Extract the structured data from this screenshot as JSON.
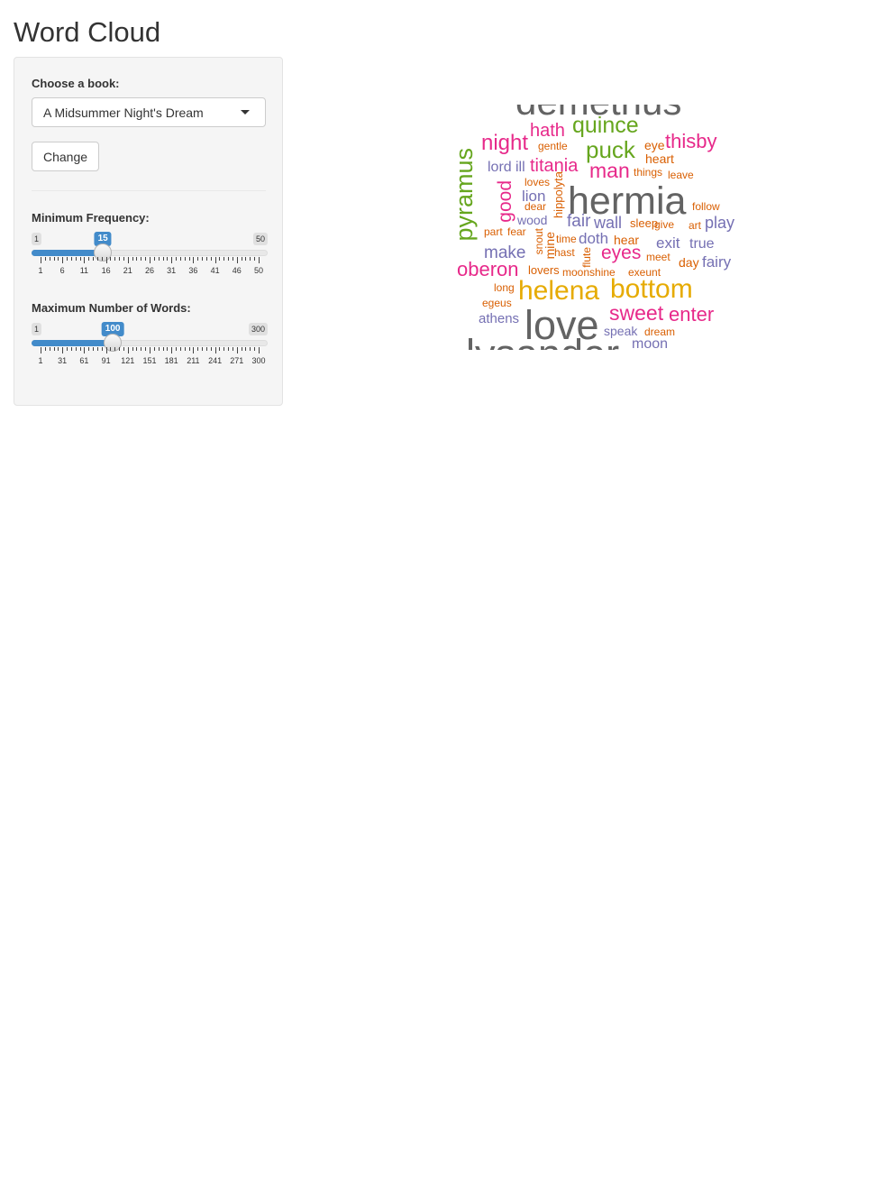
{
  "title": "Word Cloud",
  "sidebar": {
    "book_label": "Choose a book:",
    "book_selected": "A Midsummer Night's Dream",
    "change_button": "Change",
    "min_freq": {
      "label": "Minimum Frequency:",
      "min": 1,
      "max": 50,
      "value": 15,
      "min_text": "1",
      "max_text": "50",
      "value_text": "15",
      "ticks": [
        "1",
        "6",
        "11",
        "16",
        "21",
        "26",
        "31",
        "36",
        "41",
        "46",
        "50"
      ]
    },
    "max_words": {
      "label": "Maximum Number of Words:",
      "min": 1,
      "max": 300,
      "value": 100,
      "min_text": "1",
      "max_text": "300",
      "value_text": "100",
      "ticks": [
        "1",
        "31",
        "61",
        "91",
        "121",
        "151",
        "181",
        "211",
        "241",
        "271",
        "300"
      ]
    }
  },
  "colors": {
    "accent": "#428bca",
    "grey": "#636363",
    "green": "#66a61e",
    "pink": "#e7298a",
    "purple": "#7570b3",
    "orange": "#d95f02",
    "gold": "#e6ab02"
  },
  "word_cloud": [
    {
      "text": "demetrius",
      "color": "grey"
    },
    {
      "text": "hath",
      "color": "pink"
    },
    {
      "text": "quince",
      "color": "green"
    },
    {
      "text": "night",
      "color": "pink"
    },
    {
      "text": "gentle",
      "color": "orange"
    },
    {
      "text": "puck",
      "color": "green"
    },
    {
      "text": "eye",
      "color": "orange"
    },
    {
      "text": "thisby",
      "color": "pink"
    },
    {
      "text": "heart",
      "color": "orange"
    },
    {
      "text": "pyramus",
      "color": "green"
    },
    {
      "text": "lord",
      "color": "purple"
    },
    {
      "text": "ill",
      "color": "purple"
    },
    {
      "text": "titania",
      "color": "pink"
    },
    {
      "text": "man",
      "color": "pink"
    },
    {
      "text": "things",
      "color": "orange"
    },
    {
      "text": "leave",
      "color": "orange"
    },
    {
      "text": "loves",
      "color": "orange"
    },
    {
      "text": "good",
      "color": "pink"
    },
    {
      "text": "lion",
      "color": "purple"
    },
    {
      "text": "hippolyta",
      "color": "orange"
    },
    {
      "text": "hermia",
      "color": "grey"
    },
    {
      "text": "dear",
      "color": "orange"
    },
    {
      "text": "follow",
      "color": "orange"
    },
    {
      "text": "wood",
      "color": "purple"
    },
    {
      "text": "fair",
      "color": "purple"
    },
    {
      "text": "wall",
      "color": "purple"
    },
    {
      "text": "sleep",
      "color": "orange"
    },
    {
      "text": "give",
      "color": "orange"
    },
    {
      "text": "art",
      "color": "orange"
    },
    {
      "text": "play",
      "color": "purple"
    },
    {
      "text": "part",
      "color": "orange"
    },
    {
      "text": "fear",
      "color": "orange"
    },
    {
      "text": "snout",
      "color": "orange"
    },
    {
      "text": "mine",
      "color": "orange"
    },
    {
      "text": "time",
      "color": "orange"
    },
    {
      "text": "doth",
      "color": "purple"
    },
    {
      "text": "hear",
      "color": "orange"
    },
    {
      "text": "exit",
      "color": "purple"
    },
    {
      "text": "true",
      "color": "purple"
    },
    {
      "text": "make",
      "color": "purple"
    },
    {
      "text": "hast",
      "color": "orange"
    },
    {
      "text": "flute",
      "color": "orange"
    },
    {
      "text": "eyes",
      "color": "pink"
    },
    {
      "text": "meet",
      "color": "orange"
    },
    {
      "text": "day",
      "color": "orange"
    },
    {
      "text": "fairy",
      "color": "purple"
    },
    {
      "text": "oberon",
      "color": "pink"
    },
    {
      "text": "lovers",
      "color": "orange"
    },
    {
      "text": "moonshine",
      "color": "orange"
    },
    {
      "text": "exeunt",
      "color": "orange"
    },
    {
      "text": "long",
      "color": "orange"
    },
    {
      "text": "helena",
      "color": "gold"
    },
    {
      "text": "bottom",
      "color": "gold"
    },
    {
      "text": "egeus",
      "color": "orange"
    },
    {
      "text": "sweet",
      "color": "pink"
    },
    {
      "text": "enter",
      "color": "pink"
    },
    {
      "text": "athens",
      "color": "purple"
    },
    {
      "text": "love",
      "color": "grey"
    },
    {
      "text": "speak",
      "color": "purple"
    },
    {
      "text": "dream",
      "color": "orange"
    },
    {
      "text": "lysander",
      "color": "grey"
    },
    {
      "text": "moon",
      "color": "purple"
    }
  ]
}
